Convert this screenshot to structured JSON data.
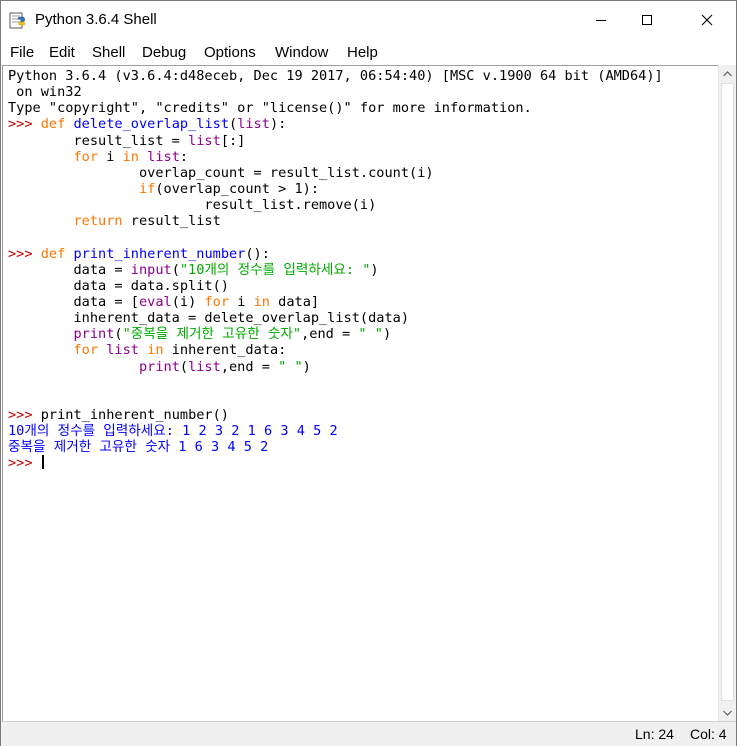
{
  "window": {
    "title": "Python 3.6.4 Shell",
    "icon": "python-idle-icon"
  },
  "menu": [
    {
      "label": "File"
    },
    {
      "label": "Edit"
    },
    {
      "label": "Shell"
    },
    {
      "label": "Debug"
    },
    {
      "label": "Options"
    },
    {
      "label": "Window"
    },
    {
      "label": "Help"
    }
  ],
  "shell": {
    "lines": [
      [
        {
          "t": "Python 3.6.4 (v3.6.4:d48eceb, Dec 19 2017, 06:54:40) [MSC v.1900 64 bit (AMD64)]",
          "c": ""
        }
      ],
      [
        {
          "t": " on win32",
          "c": ""
        }
      ],
      [
        {
          "t": "Type \"copyright\", \"credits\" or \"license()\" for more information.",
          "c": ""
        }
      ],
      [
        {
          "t": ">>> ",
          "c": "prompt"
        },
        {
          "t": "def",
          "c": "kw"
        },
        {
          "t": " ",
          "c": ""
        },
        {
          "t": "delete_overlap_list",
          "c": "fn"
        },
        {
          "t": "(",
          "c": ""
        },
        {
          "t": "list",
          "c": "bi"
        },
        {
          "t": "):",
          "c": ""
        }
      ],
      [
        {
          "t": "        result_list = ",
          "c": ""
        },
        {
          "t": "list",
          "c": "bi"
        },
        {
          "t": "[:]",
          "c": ""
        }
      ],
      [
        {
          "t": "        ",
          "c": ""
        },
        {
          "t": "for",
          "c": "kw"
        },
        {
          "t": " i ",
          "c": ""
        },
        {
          "t": "in",
          "c": "kw"
        },
        {
          "t": " ",
          "c": ""
        },
        {
          "t": "list",
          "c": "bi"
        },
        {
          "t": ":",
          "c": ""
        }
      ],
      [
        {
          "t": "                overlap_count = result_list.count(i)",
          "c": ""
        }
      ],
      [
        {
          "t": "                ",
          "c": ""
        },
        {
          "t": "if",
          "c": "kw"
        },
        {
          "t": "(overlap_count > 1):",
          "c": ""
        }
      ],
      [
        {
          "t": "                        result_list.remove(i)",
          "c": ""
        }
      ],
      [
        {
          "t": "        ",
          "c": ""
        },
        {
          "t": "return",
          "c": "kw"
        },
        {
          "t": " result_list",
          "c": ""
        }
      ],
      [
        {
          "t": "",
          "c": ""
        }
      ],
      [
        {
          "t": ">>> ",
          "c": "prompt"
        },
        {
          "t": "def",
          "c": "kw"
        },
        {
          "t": " ",
          "c": ""
        },
        {
          "t": "print_inherent_number",
          "c": "fn"
        },
        {
          "t": "():",
          "c": ""
        }
      ],
      [
        {
          "t": "        data = ",
          "c": ""
        },
        {
          "t": "input",
          "c": "bi"
        },
        {
          "t": "(",
          "c": ""
        },
        {
          "t": "\"10개의 정수를 입력하세요: \"",
          "c": "str"
        },
        {
          "t": ")",
          "c": ""
        }
      ],
      [
        {
          "t": "        data = data.split()",
          "c": ""
        }
      ],
      [
        {
          "t": "        data = [",
          "c": ""
        },
        {
          "t": "eval",
          "c": "bi"
        },
        {
          "t": "(i) ",
          "c": ""
        },
        {
          "t": "for",
          "c": "kw"
        },
        {
          "t": " i ",
          "c": ""
        },
        {
          "t": "in",
          "c": "kw"
        },
        {
          "t": " data]",
          "c": ""
        }
      ],
      [
        {
          "t": "        inherent_data = delete_overlap_list(data)",
          "c": ""
        }
      ],
      [
        {
          "t": "        ",
          "c": ""
        },
        {
          "t": "print",
          "c": "bi"
        },
        {
          "t": "(",
          "c": ""
        },
        {
          "t": "\"중복을 제거한 고유한 숫자\"",
          "c": "str"
        },
        {
          "t": ",end = ",
          "c": ""
        },
        {
          "t": "\" \"",
          "c": "str"
        },
        {
          "t": ")",
          "c": ""
        }
      ],
      [
        {
          "t": "        ",
          "c": ""
        },
        {
          "t": "for",
          "c": "kw"
        },
        {
          "t": " ",
          "c": ""
        },
        {
          "t": "list",
          "c": "bi"
        },
        {
          "t": " ",
          "c": ""
        },
        {
          "t": "in",
          "c": "kw"
        },
        {
          "t": " inherent_data:",
          "c": ""
        }
      ],
      [
        {
          "t": "                ",
          "c": ""
        },
        {
          "t": "print",
          "c": "bi"
        },
        {
          "t": "(",
          "c": ""
        },
        {
          "t": "list",
          "c": "bi"
        },
        {
          "t": ",end = ",
          "c": ""
        },
        {
          "t": "\" \"",
          "c": "str"
        },
        {
          "t": ")",
          "c": ""
        }
      ],
      [
        {
          "t": "",
          "c": ""
        }
      ],
      [
        {
          "t": "",
          "c": ""
        }
      ],
      [
        {
          "t": ">>> ",
          "c": "prompt"
        },
        {
          "t": "print_inherent_number()",
          "c": ""
        }
      ],
      [
        {
          "t": "10개의 정수를 입력하세요: 1 2 3 2 1 6 3 4 5 2",
          "c": "out"
        }
      ],
      [
        {
          "t": "중복을 제거한 고유한 숫자 1 6 3 4 5 2",
          "c": "out"
        }
      ],
      [
        {
          "t": ">>> ",
          "c": "prompt"
        }
      ]
    ]
  },
  "status": {
    "line": "Ln: 24",
    "col": "Col: 4"
  }
}
